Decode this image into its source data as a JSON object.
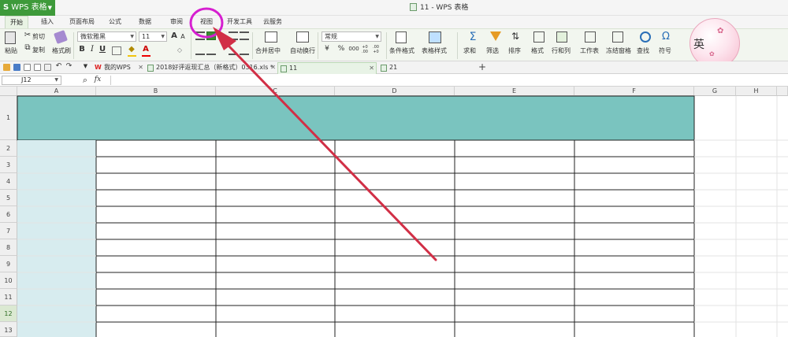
{
  "app": {
    "name": "WPS 表格",
    "window_title": "11 - WPS 表格"
  },
  "ribbon_tabs": [
    {
      "label": "开始",
      "active": true
    },
    {
      "label": "插入"
    },
    {
      "label": "页面布局"
    },
    {
      "label": "公式"
    },
    {
      "label": "数据"
    },
    {
      "label": "审阅"
    },
    {
      "label": "视图"
    },
    {
      "label": "开发工具"
    },
    {
      "label": "云服务"
    }
  ],
  "ribbon": {
    "paste": "粘贴",
    "cut": "剪切",
    "copy": "复制",
    "format_painter": "格式刷",
    "font_name": "微软雅黑",
    "font_size": "11",
    "bold": "B",
    "italic": "I",
    "underline": "U",
    "grow_font": "A",
    "shrink_font": "A",
    "merge_center": "合并居中",
    "wrap_text": "自动换行",
    "number_format": "常规",
    "currency": "¥",
    "percent": "%",
    "thousands": "000",
    "inc_decimal": "+0 .00",
    "dec_decimal": ".00 +0",
    "conditional_format": "条件格式",
    "table_style": "表格样式",
    "sum": "求和",
    "filter": "筛选",
    "sort": "排序",
    "format": "格式",
    "row_col": "行和列",
    "worksheet": "工作表",
    "freeze_panes": "冻结窗格",
    "find": "查找",
    "symbol": "符号",
    "sum_glyph": "Σ",
    "symbol_glyph": "Ω",
    "avatar_char": "英"
  },
  "doc_tabs": [
    {
      "label": "我的WPS"
    },
    {
      "label": "2018好评返现汇总（新格式）0316.xls *"
    },
    {
      "label": "11",
      "active": true
    },
    {
      "label": "21"
    }
  ],
  "formula_bar": {
    "cell_ref": "J12",
    "fx": "fx",
    "zoom_glyph": "⌕"
  },
  "columns": [
    "A",
    "B",
    "C",
    "D",
    "E",
    "F",
    "G",
    "H"
  ],
  "rows": [
    "1",
    "2",
    "3",
    "4",
    "5",
    "6",
    "7",
    "8",
    "9",
    "10",
    "11",
    "12",
    "13"
  ],
  "selected_row": "12",
  "colors": {
    "header_fill": "#7ac4bf",
    "col_a_fill": "#d7ecef",
    "annotation": "#d12f46",
    "circle": "#d61fd0",
    "wps_green": "#3e9a3a"
  }
}
